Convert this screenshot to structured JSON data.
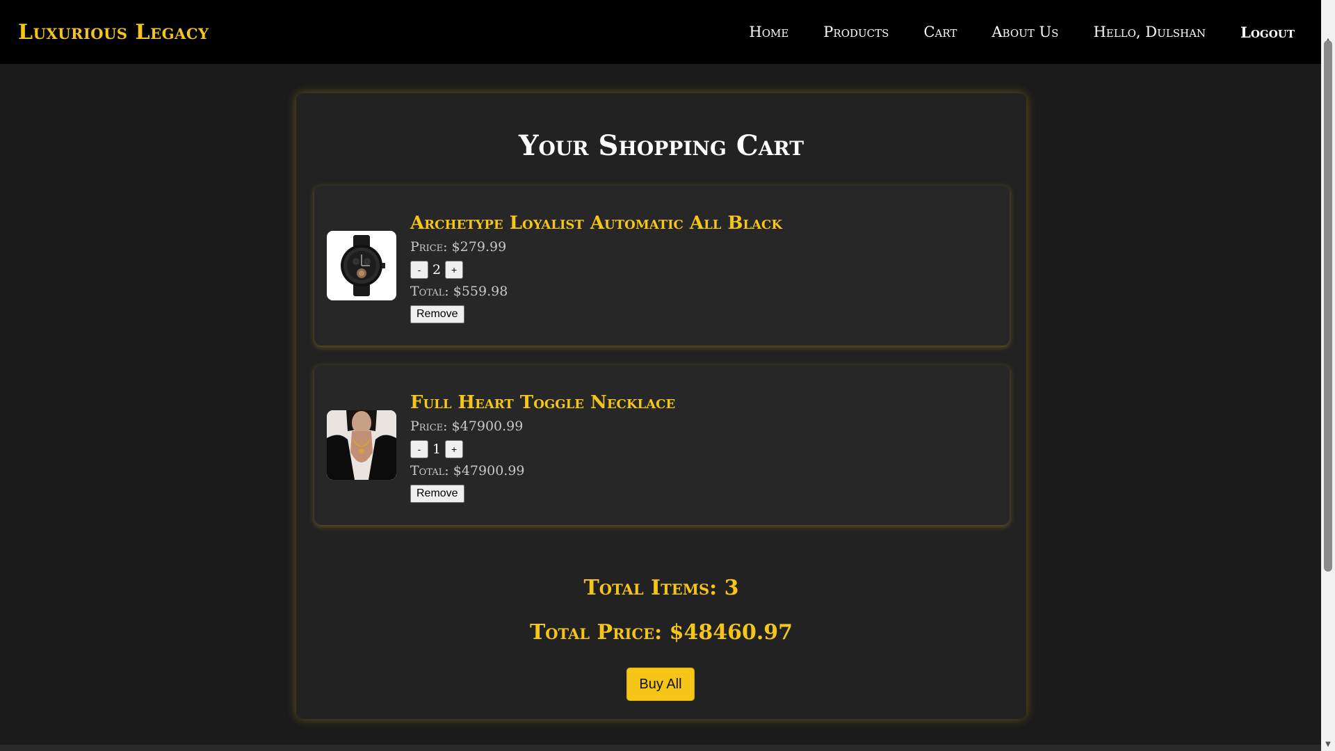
{
  "brand": "Luxurious Legacy",
  "nav": {
    "home": "Home",
    "products": "Products",
    "cart": "Cart",
    "about": "About Us",
    "greeting": "Hello, Dulshan",
    "logout": "Logout"
  },
  "page_title": "Your Shopping Cart",
  "cart": {
    "items": [
      {
        "name": "Archetype Loyalist Automatic All Black",
        "price": "Price: $279.99",
        "quantity": "2",
        "total": "Total: $559.98",
        "decrement": "-",
        "increment": "+",
        "remove": "Remove"
      },
      {
        "name": "Full Heart Toggle Necklace",
        "price": "Price: $47900.99",
        "quantity": "1",
        "total": "Total: $47900.99",
        "decrement": "-",
        "increment": "+",
        "remove": "Remove"
      }
    ]
  },
  "summary": {
    "total_items": "Total Items: 3",
    "total_price": "Total Price: $48460.97",
    "buy_all": "Buy All"
  },
  "colors": {
    "accent": "#f5c518",
    "header_bg": "#000000",
    "page_bg": "#1b1b1b",
    "panel_bg": "#222222"
  }
}
